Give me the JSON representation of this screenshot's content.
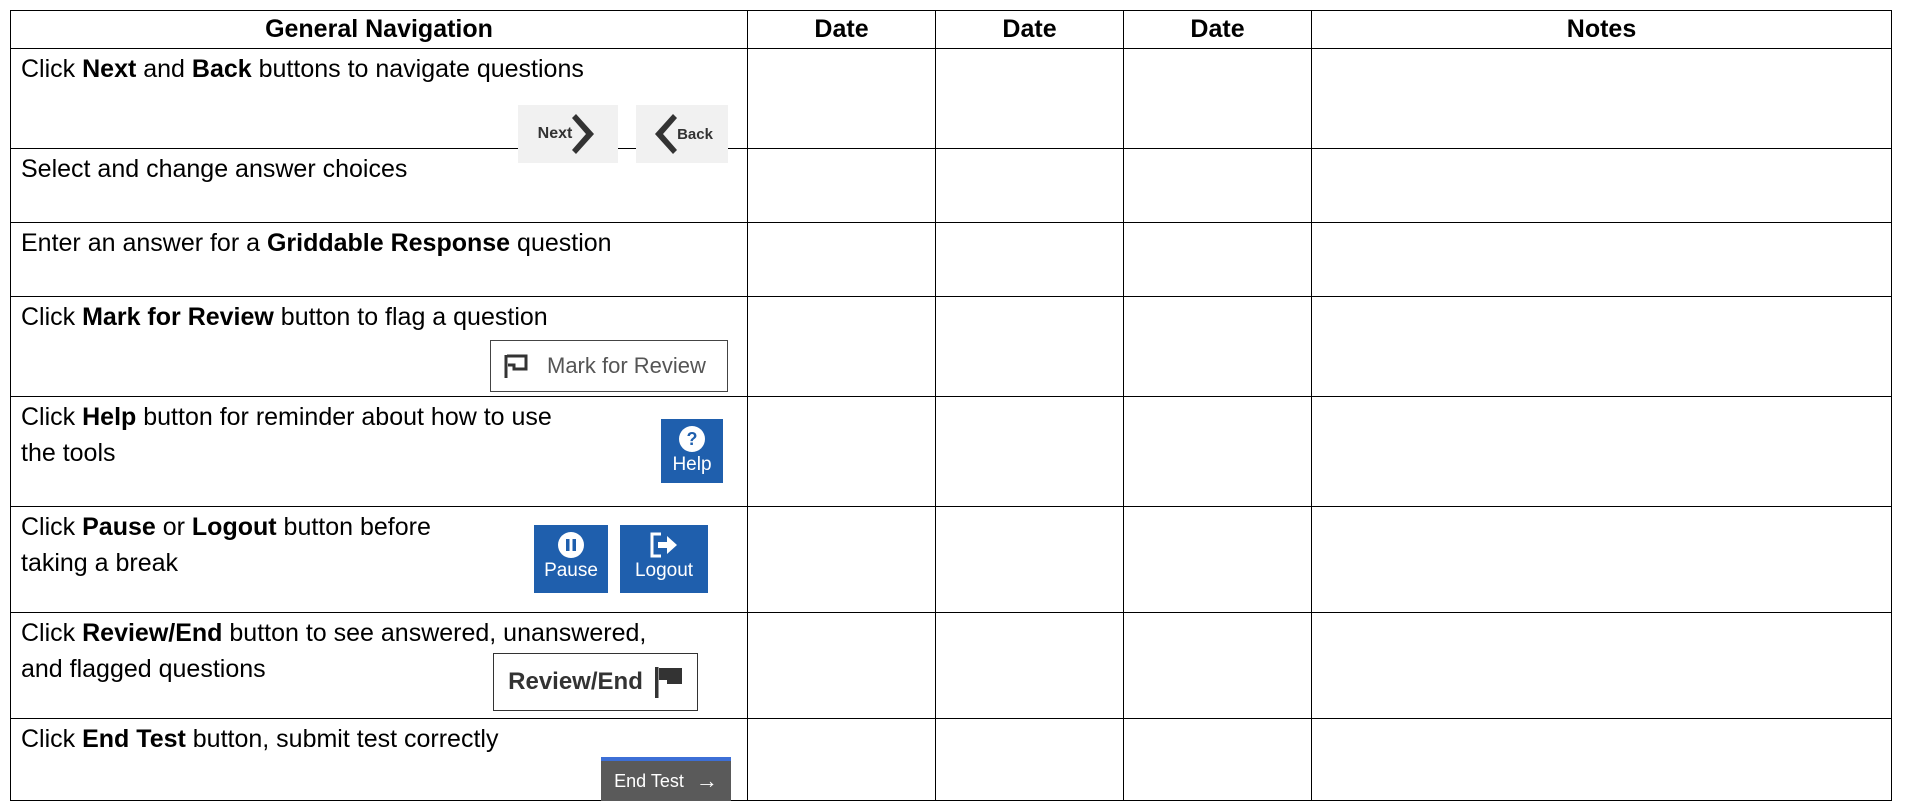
{
  "headers": {
    "nav": "General Navigation",
    "date1": "Date",
    "date2": "Date",
    "date3": "Date",
    "notes": "Notes"
  },
  "rows": [
    {
      "parts": [
        {
          "t": "Click "
        },
        {
          "t": "Next",
          "b": true
        },
        {
          "t": " and "
        },
        {
          "t": "Back",
          "b": true
        },
        {
          "t": " buttons to navigate questions"
        }
      ]
    },
    {
      "parts": [
        {
          "t": "Select and change answer choices"
        }
      ]
    },
    {
      "parts": [
        {
          "t": "Enter an answer for a "
        },
        {
          "t": "Griddable Response",
          "b": true
        },
        {
          "t": " question"
        }
      ]
    },
    {
      "parts": [
        {
          "t": "Click "
        },
        {
          "t": "Mark for Review",
          "b": true
        },
        {
          "t": " button to flag a question"
        }
      ]
    },
    {
      "parts": [
        {
          "t": "Click "
        },
        {
          "t": "Help",
          "b": true
        },
        {
          "t": " button for reminder about how to use\nthe tools"
        }
      ]
    },
    {
      "parts": [
        {
          "t": "Click "
        },
        {
          "t": "Pause",
          "b": true
        },
        {
          "t": " or "
        },
        {
          "t": "Logout",
          "b": true
        },
        {
          "t": " button before\ntaking a break"
        }
      ]
    },
    {
      "parts": [
        {
          "t": "Click "
        },
        {
          "t": "Review/End",
          "b": true
        },
        {
          "t": " button to see answered, unanswered,\nand flagged questions"
        }
      ]
    },
    {
      "parts": [
        {
          "t": "Click "
        },
        {
          "t": "End Test",
          "b": true
        },
        {
          "t": " button, submit test correctly"
        }
      ]
    }
  ],
  "buttons": {
    "next": "Next",
    "back": "Back",
    "mark_review": "Mark for Review",
    "help": "Help",
    "pause": "Pause",
    "logout": "Logout",
    "review_end": "Review/End",
    "end_test": "End Test"
  },
  "icons": {
    "next": "chevron-right-icon",
    "back": "chevron-left-icon",
    "mark": "flag-outline-icon",
    "help": "question-circle-icon",
    "pause": "pause-circle-icon",
    "logout": "logout-arrow-icon",
    "review": "flag-filled-icon",
    "end_test": "arrow-right-icon"
  },
  "colors": {
    "blue_button": "#1f5fad",
    "end_test_bg": "#5a5a5a",
    "end_test_accent": "#3d6fd6"
  }
}
